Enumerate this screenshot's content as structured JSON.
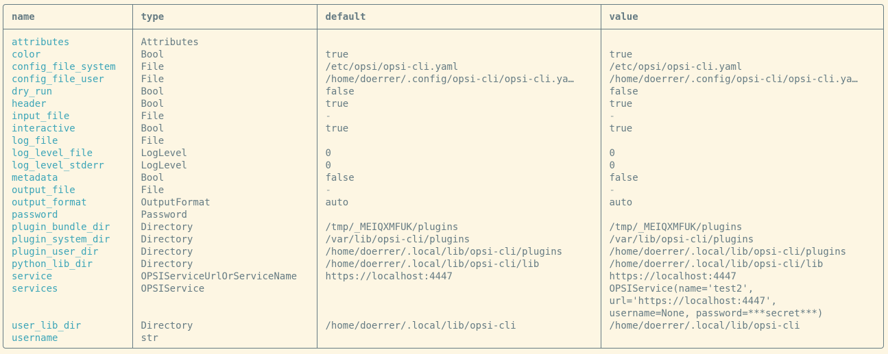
{
  "colors": {
    "background": "#fdf6e3",
    "border": "#657b83",
    "text": "#657b83",
    "name_text": "#3ca5b8",
    "muted_text": "#93a1a1"
  },
  "table": {
    "headers": {
      "name": "name",
      "type": "type",
      "default": "default",
      "value": "value"
    },
    "rows": [
      {
        "name": "attributes",
        "type": "Attributes",
        "default": "",
        "value": ""
      },
      {
        "name": "color",
        "type": "Bool",
        "default": "true",
        "value": "true"
      },
      {
        "name": "config_file_system",
        "type": "File",
        "default": "/etc/opsi/opsi-cli.yaml",
        "value": "/etc/opsi/opsi-cli.yaml"
      },
      {
        "name": "config_file_user",
        "type": "File",
        "default": "/home/doerrer/.config/opsi-cli/opsi-cli.ya…",
        "value": "/home/doerrer/.config/opsi-cli/opsi-cli.ya…"
      },
      {
        "name": "dry_run",
        "type": "Bool",
        "default": "false",
        "value": "false"
      },
      {
        "name": "header",
        "type": "Bool",
        "default": "true",
        "value": "true"
      },
      {
        "name": "input_file",
        "type": "File",
        "default": "-",
        "value": "-"
      },
      {
        "name": "interactive",
        "type": "Bool",
        "default": "true",
        "value": "true"
      },
      {
        "name": "log_file",
        "type": "File",
        "default": "",
        "value": ""
      },
      {
        "name": "log_level_file",
        "type": "LogLevel",
        "default": "0",
        "value": "0"
      },
      {
        "name": "log_level_stderr",
        "type": "LogLevel",
        "default": "0",
        "value": "0"
      },
      {
        "name": "metadata",
        "type": "Bool",
        "default": "false",
        "value": "false"
      },
      {
        "name": "output_file",
        "type": "File",
        "default": "-",
        "value": "-"
      },
      {
        "name": "output_format",
        "type": "OutputFormat",
        "default": "auto",
        "value": "auto"
      },
      {
        "name": "password",
        "type": "Password",
        "default": "",
        "value": ""
      },
      {
        "name": "plugin_bundle_dir",
        "type": "Directory",
        "default": "/tmp/_MEIQXMFUK/plugins",
        "value": "/tmp/_MEIQXMFUK/plugins"
      },
      {
        "name": "plugin_system_dir",
        "type": "Directory",
        "default": "/var/lib/opsi-cli/plugins",
        "value": "/var/lib/opsi-cli/plugins"
      },
      {
        "name": "plugin_user_dir",
        "type": "Directory",
        "default": "/home/doerrer/.local/lib/opsi-cli/plugins",
        "value": "/home/doerrer/.local/lib/opsi-cli/plugins"
      },
      {
        "name": "python_lib_dir",
        "type": "Directory",
        "default": "/home/doerrer/.local/lib/opsi-cli/lib",
        "value": "/home/doerrer/.local/lib/opsi-cli/lib"
      },
      {
        "name": "service",
        "type": "OPSIServiceUrlOrServiceName",
        "default": "https://localhost:4447",
        "value": "https://localhost:4447"
      },
      {
        "name": "services",
        "type": "OPSIService",
        "default": "",
        "value": "OPSIService(name='test2',\nurl='https://localhost:4447',\nusername=None, password=***secret***)"
      },
      {
        "name": "user_lib_dir",
        "type": "Directory",
        "default": "/home/doerrer/.local/lib/opsi-cli",
        "value": "/home/doerrer/.local/lib/opsi-cli"
      },
      {
        "name": "username",
        "type": "str",
        "default": "",
        "value": ""
      }
    ]
  }
}
